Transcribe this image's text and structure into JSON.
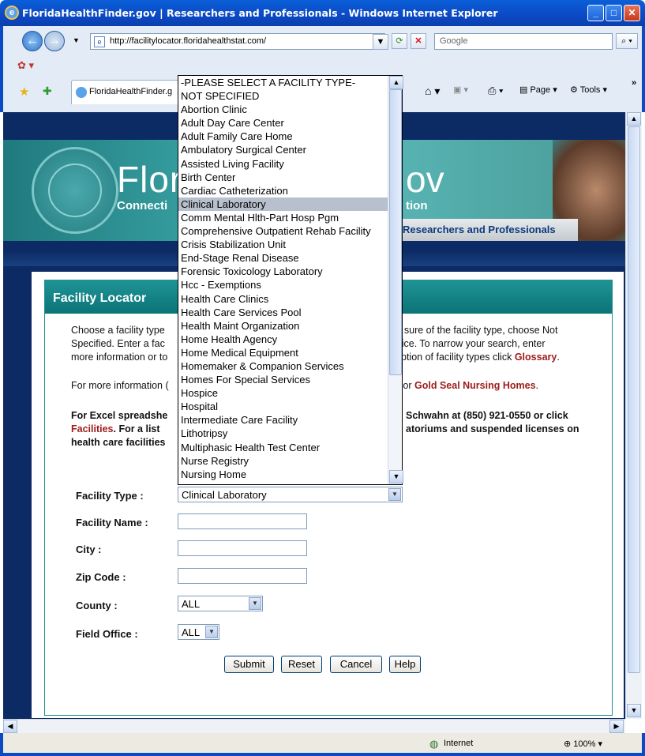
{
  "window": {
    "title": "FloridaHealthFinder.gov | Researchers and Professionals - Windows Internet Explorer"
  },
  "browser": {
    "url": "http://facilitylocator.floridahealthstat.com/",
    "search_placeholder": "Google",
    "tab_title": "FloridaHealthFinder.g",
    "commands": {
      "page": "Page",
      "tools": "Tools"
    },
    "status_zone": "Internet",
    "zoom": "100%"
  },
  "site": {
    "brand_left": "Flori",
    "brand_right": "ov",
    "tagline_left": "Connecti",
    "tagline_right": "tion",
    "section_tab": "Researchers and Professionals",
    "seal_text": "GREAT SEAL OF THE STATE OF FLORIDA · IN GOD WE TRUST"
  },
  "locator": {
    "header": "Facility Locator",
    "intro": {
      "line1_left": "Choose a facility type",
      "line1_right": "ot sure of the facility type, choose Not",
      "line2_left": "Specified. Enter a fac",
      "line2_right": "ffice. To narrow your search, enter",
      "line3_left": "more information or to",
      "line3_right": "ption of facility types click",
      "glossary_link": "Glossary",
      "period": "."
    },
    "more_info": {
      "left": "For more information (",
      "mid": "e",
      "or": " or ",
      "gold_seal_link": "Gold Seal Nursing Homes",
      "end": "."
    },
    "excel": {
      "line1_left": "For Excel spreadshe",
      "line1_right": "Schwahn at (850) 921-0550 or click",
      "facilities_link": "Facilities",
      "line2_mid": ". For a list",
      "line2_right": "atoriums and suspended licenses on",
      "line3_left": "health care facilities"
    },
    "form": {
      "facility_type_label": "Facility Type :",
      "facility_type_value": "Clinical Laboratory",
      "facility_name_label": "Facility Name :",
      "city_label": "City :",
      "zip_label": "Zip Code :",
      "county_label": "County :",
      "county_value": "ALL",
      "field_office_label": "Field Office :",
      "field_office_value": "ALL"
    },
    "buttons": {
      "submit": "Submit",
      "reset": "Reset",
      "cancel": "Cancel",
      "help": "Help"
    }
  },
  "facility_type_options": [
    "-PLEASE SELECT A FACILITY TYPE-",
    "NOT SPECIFIED",
    "Abortion Clinic",
    "Adult Day Care Center",
    "Adult Family Care Home",
    "Ambulatory Surgical Center",
    "Assisted Living Facility",
    "Birth Center",
    "Cardiac Catheterization",
    "Clinical Laboratory",
    "Comm Mental Hlth-Part Hosp Pgm",
    "Comprehensive Outpatient Rehab Facility",
    "Crisis Stabilization Unit",
    "End-Stage Renal Disease",
    "Forensic Toxicology Laboratory",
    "Hcc - Exemptions",
    "Health Care Clinics",
    "Health Care Services Pool",
    "Health Maint Organization",
    "Home Health Agency",
    "Home Medical Equipment",
    "Homemaker & Companion Services",
    "Homes For Special Services",
    "Hospice",
    "Hospital",
    "Intermediate Care Facility",
    "Lithotripsy",
    "Multiphasic Health Test Center",
    "Nurse Registry",
    "Nursing Home"
  ],
  "selected_option_index": 9
}
